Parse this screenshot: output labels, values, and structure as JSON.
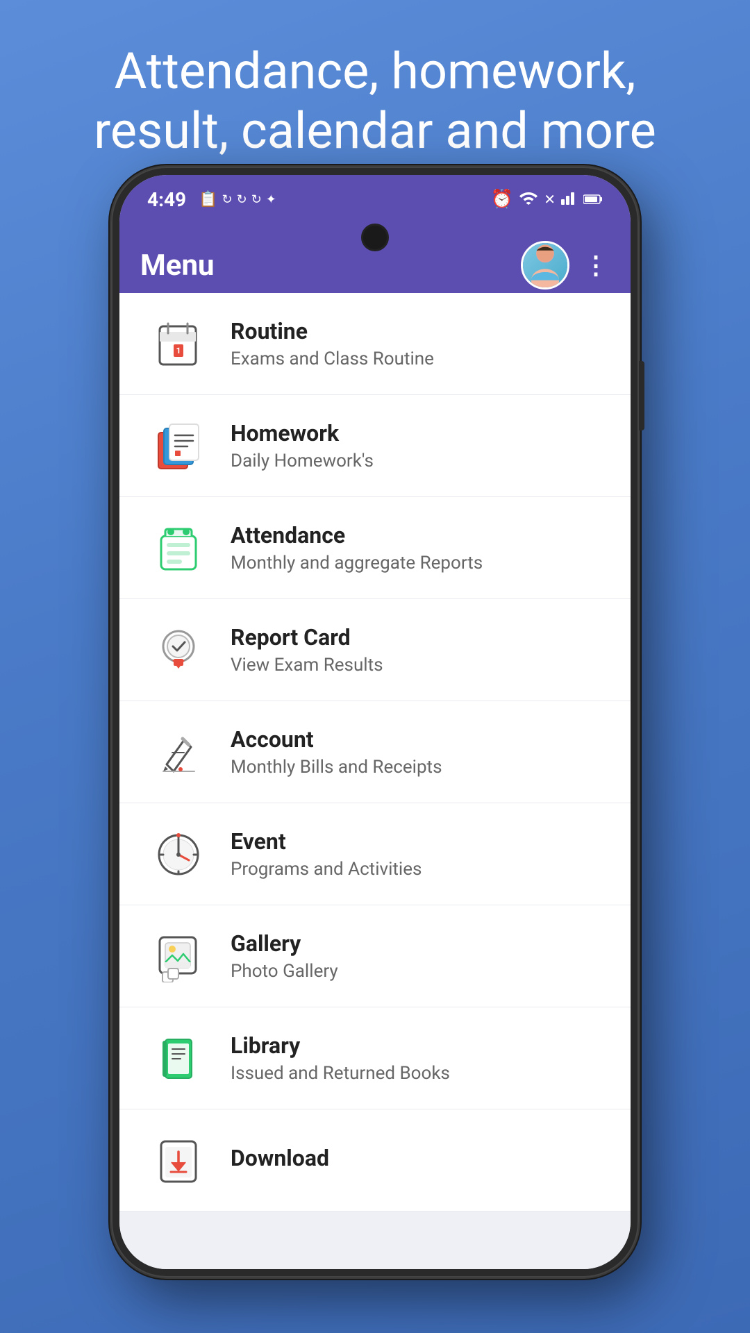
{
  "background": {
    "headline": "Attendance, homework, result, calendar and more"
  },
  "status_bar": {
    "time": "4:49",
    "icons_left": [
      "📎",
      "↺",
      "↺",
      "↺",
      "✦"
    ],
    "icons_right": [
      "⏰",
      "📶",
      "📶",
      "🔋"
    ]
  },
  "app_bar": {
    "title": "Menu",
    "more_icon": "⋮"
  },
  "menu_items": [
    {
      "id": "routine",
      "title": "Routine",
      "subtitle": "Exams and Class Routine",
      "icon_type": "calendar"
    },
    {
      "id": "homework",
      "title": "Homework",
      "subtitle": "Daily Homework's",
      "icon_type": "books"
    },
    {
      "id": "attendance",
      "title": "Attendance",
      "subtitle": "Monthly and aggregate Reports",
      "icon_type": "bag"
    },
    {
      "id": "report-card",
      "title": "Report Card",
      "subtitle": "View Exam Results",
      "icon_type": "certificate"
    },
    {
      "id": "account",
      "title": "Account",
      "subtitle": "Monthly Bills and Receipts",
      "icon_type": "pen"
    },
    {
      "id": "event",
      "title": "Event",
      "subtitle": "Programs and Activities",
      "icon_type": "clock"
    },
    {
      "id": "gallery",
      "title": "Gallery",
      "subtitle": "Photo Gallery",
      "icon_type": "photo"
    },
    {
      "id": "library",
      "title": "Library",
      "subtitle": "Issued and Returned Books",
      "icon_type": "book-stack"
    },
    {
      "id": "download",
      "title": "Download",
      "subtitle": "",
      "icon_type": "download"
    }
  ]
}
